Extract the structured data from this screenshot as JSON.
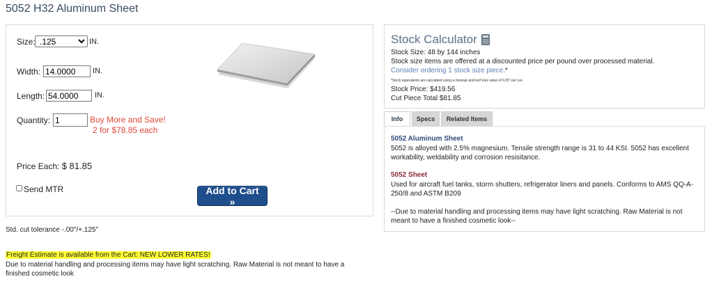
{
  "page": {
    "title": "5052 H32 Aluminum Sheet"
  },
  "config": {
    "size_label": "Size:",
    "size_value": ".125",
    "size_unit": "IN.",
    "width_label": "Width:",
    "width_value": "14.0000",
    "width_unit": "IN.",
    "length_label": "Length:",
    "length_value": "54.0000",
    "length_unit": "IN.",
    "quantity_label": "Quantity:",
    "quantity_value": "1",
    "promo_line1": "Buy More and Save!",
    "promo_line2": "2 for $78.85 each",
    "price_label": "Price Each:",
    "price_value": "$ 81.85",
    "send_mtr_label": "Send MTR",
    "send_mtr_checked": false,
    "add_to_cart_label": "Add to Cart »"
  },
  "notes": {
    "tolerance": "Std. cut tolerance -.00\"/+.125\"",
    "freight": "Freight Estimate is available from the Cart: NEW LOWER RATES!",
    "disclaimer": "Due to material handling and processing items may have light scratching. Raw Material is not meant to have a finished cosmetic look"
  },
  "calculator": {
    "title": "Stock Calculator",
    "icon": "calculator-icon",
    "stock_size": "Stock Size: 48 by 144 inches",
    "discount_note": "Stock size items are offered at a discounted price per pound over processed material.",
    "link_text": "Consider ordering 1 stock size piece.",
    "link_suffix": "*",
    "fine_print": "*Stock equivalents are calculated using a cleanup and kerf loss value of 0.25\" per cut.",
    "stock_price": "Stock Price: $419.56",
    "cut_piece_total": "Cut Piece Total $81.85"
  },
  "tabs": [
    {
      "label": "Info",
      "active": true
    },
    {
      "label": "Specs",
      "active": false
    },
    {
      "label": "Related Items",
      "active": false
    }
  ],
  "info": {
    "heading1": "5052 Aluminum Sheet",
    "heading1_color": "#2e4a7a",
    "text1": "5052 is alloyed with 2.5% magnesium. Tensile strength range is 31 to 44 KSI. 5052 has excellent workability, weldability and corrosion resisitance.",
    "heading2": "5052 Sheet",
    "heading2_color": "#8b2a3a",
    "text2": "Used for aircraft fuel tanks, storm shutters, refrigerator liners and panels. Conforms to AMS QQ-A-250/8 and ASTM B209",
    "text3": "--Due to material handling and processing items may have light scratching. Raw Material is not meant to have a finished cosmetic look--"
  },
  "colors": {
    "accent_button": "#1f4e8c",
    "promo": "#e0473b",
    "highlight": "#ffff33",
    "link": "#5b7fb8"
  }
}
